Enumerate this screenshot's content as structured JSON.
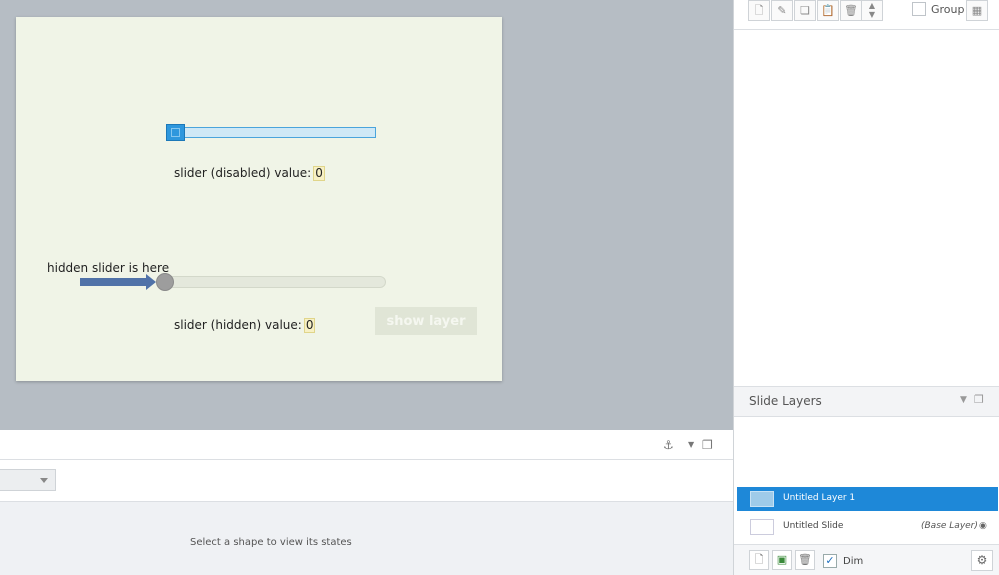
{
  "slide": {
    "disabled_slider": {
      "caption": "slider (disabled) value:",
      "value": "0"
    },
    "hidden_slider": {
      "annotation": "hidden slider is here",
      "caption": "slider (hidden) value:",
      "value": "0"
    },
    "show_layer_button": "show layer"
  },
  "states_panel": {
    "empty_message": "Select a shape to view its states"
  },
  "right_panel": {
    "group_label": "Group",
    "slide_layers": {
      "title": "Slide Layers",
      "layers": [
        {
          "name": "Untitled Layer 1",
          "selected": true
        },
        {
          "name": "Untitled Slide",
          "tag": "(Base Layer)"
        }
      ]
    },
    "dim_label": "Dim"
  },
  "colors": {
    "accent": "#1e88d8",
    "slide_bg": "#f0f4e7",
    "arrow": "#5072a8"
  }
}
